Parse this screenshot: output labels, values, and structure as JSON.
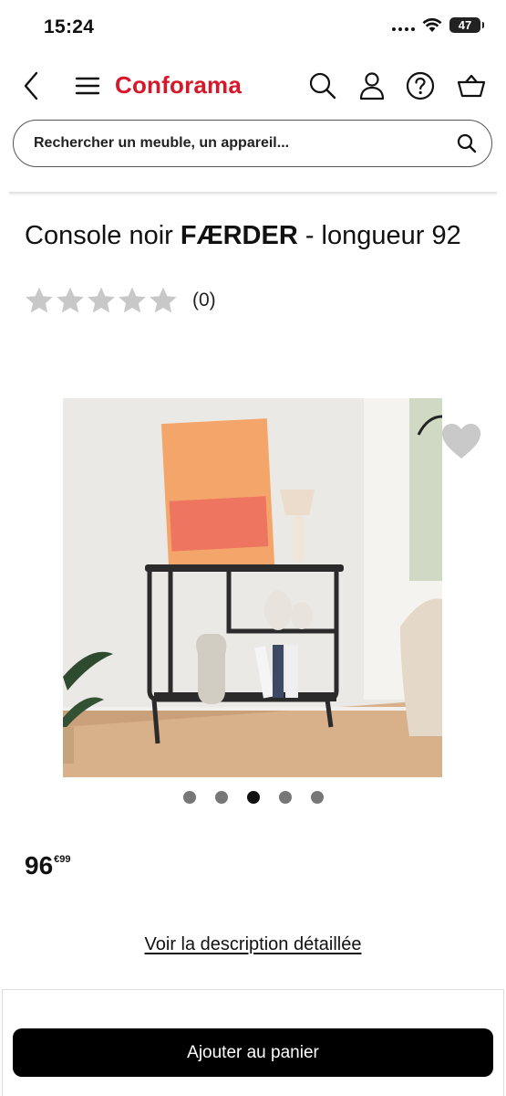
{
  "status_bar": {
    "time": "15:24",
    "battery": "47"
  },
  "header": {
    "logo": "Conforama"
  },
  "search": {
    "placeholder": "Rechercher un meuble, un appareil..."
  },
  "product": {
    "title_prefix": "Console noir ",
    "title_brand": "FÆRDER",
    "title_suffix": " - longueur 92",
    "rating_stars": 0,
    "rating_max": 5,
    "review_count": "(0)",
    "price_integer": "96",
    "price_cents": "€99",
    "carousel_total": 5,
    "carousel_active_index": 2
  },
  "description_link": "Voir la description détaillée",
  "add_to_cart_label": "Ajouter au panier",
  "colors": {
    "brand": "#d7182a",
    "primary_button": "#000000",
    "star_empty": "#c8c8c8"
  }
}
